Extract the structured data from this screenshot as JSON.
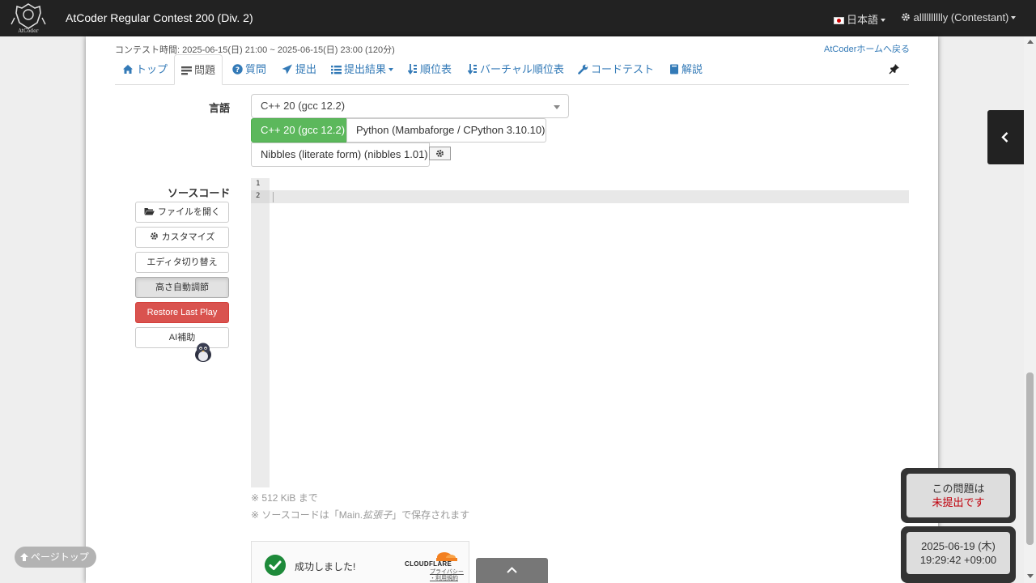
{
  "navbar": {
    "logo_text": "AtCoder",
    "title": "AtCoder Regular Contest 200 (Div. 2)",
    "language": "日本語",
    "user": "alllllllllly (Contestant)"
  },
  "contest_time": "コンテスト時間: 2025-06-15(日) 21:00 ~ 2025-06-15(日) 23:00 (120分)",
  "home_link": "AtCoderホームへ戻る",
  "tabs": [
    {
      "label": "トップ",
      "icon": "home-icon"
    },
    {
      "label": "問題",
      "icon": "list-icon",
      "active": true
    },
    {
      "label": "質問",
      "icon": "question-icon"
    },
    {
      "label": "提出",
      "icon": "send-icon"
    },
    {
      "label": "提出結果",
      "icon": "list-icon"
    },
    {
      "label": "順位表",
      "icon": "sort-icon"
    },
    {
      "label": "バーチャル順位表",
      "icon": "sort-icon"
    },
    {
      "label": "コードテスト",
      "icon": "wrench-icon"
    },
    {
      "label": "解説",
      "icon": "book-icon"
    }
  ],
  "form": {
    "language_label": "言語",
    "language_selected": "C++ 20 (gcc 12.2)",
    "language_buttons": [
      "C++ 20 (gcc 12.2)",
      "Python (Mambaforge / CPython 3.10.10)",
      "Nibbles (literate form) (nibbles 1.01)"
    ],
    "source_label": "ソースコード",
    "side_buttons": {
      "open_file": "ファイルを開く",
      "customize": "カスタマイズ",
      "switch_editor": "エディタ切り替え",
      "auto_height": "高さ自動調節",
      "restore": "Restore Last Play",
      "ai": "AI補助"
    },
    "line_numbers": [
      "1",
      "2"
    ],
    "note_size": "※ 512 KiB まで",
    "note_save_prefix": "※ ソースコードは「Main.",
    "note_save_ext": "拡張子",
    "note_save_suffix": "」で保存されます"
  },
  "cloudflare": {
    "status": "成功しました!",
    "brand": "CLOUDFLARE",
    "link1": "プライバシー",
    "link2": "・利用規約"
  },
  "page_top": "ページトップ",
  "status_widget": {
    "line1": "この問題は",
    "line2": "未提出です"
  },
  "clock_widget": {
    "date": "2025-06-19 (木)",
    "time": "19:29:42 +09:00"
  },
  "colors": {
    "accent": "#337ab7",
    "success": "#5cb85c",
    "danger": "#d9534f",
    "navbar": "#222222"
  }
}
